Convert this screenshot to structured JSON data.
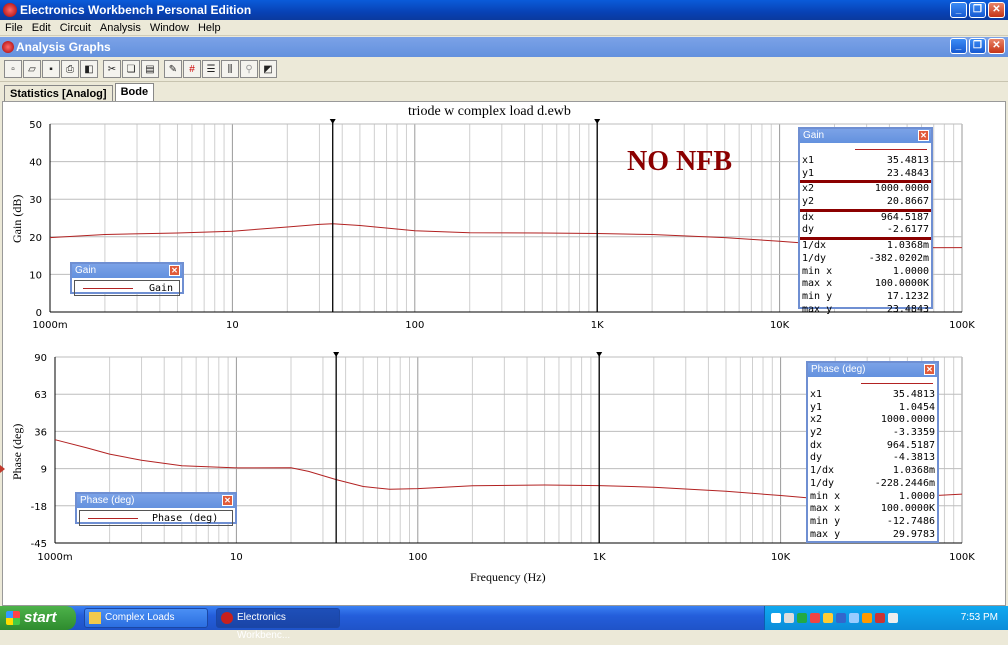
{
  "app": {
    "title": "Electronics Workbench Personal Edition"
  },
  "menu": [
    "File",
    "Edit",
    "Circuit",
    "Analysis",
    "Window",
    "Help"
  ],
  "subwindow": {
    "title": "Analysis Graphs"
  },
  "toolbar": [
    "new-icon",
    "open-icon",
    "save-icon",
    "print-icon",
    "print-preview-icon",
    "cut-icon",
    "copy-icon",
    "paste-icon",
    "properties-icon",
    "grid-icon",
    "legend-icon",
    "cursors-icon",
    "zoom-icon",
    "reverse-colors-icon"
  ],
  "tabs": [
    {
      "label": "Statistics [Analog]",
      "active": false
    },
    {
      "label": "Bode",
      "active": true
    }
  ],
  "graph": {
    "title": "triode w complex load d.ewb",
    "annotation": "NO NFB",
    "xlabel": "Frequency (Hz)"
  },
  "chart_data": [
    {
      "type": "line",
      "name": "Gain",
      "ylabel": "Gain (dB)",
      "xscale": "log",
      "xlim": [
        1,
        100000
      ],
      "ylim": [
        0,
        50
      ],
      "xticks": [
        "1000m",
        "10",
        "100",
        "1K",
        "10K",
        "100K"
      ],
      "yticks": [
        "0",
        "10",
        "20",
        "30",
        "40",
        "50"
      ],
      "grid": true,
      "series": [
        {
          "name": "Gain",
          "color": "#B22222",
          "x": [
            1,
            2,
            5,
            10,
            20,
            30,
            35.48,
            50,
            100,
            200,
            500,
            1000,
            2000,
            5000,
            10000,
            20000,
            50000,
            100000
          ],
          "y": [
            19.8,
            20.6,
            21.0,
            21.5,
            22.6,
            23.3,
            23.48,
            23.0,
            21.6,
            21.1,
            21.0,
            20.87,
            20.6,
            19.8,
            18.8,
            17.7,
            17.1,
            17.12
          ]
        }
      ],
      "cursors": {
        "x1": 35.4813,
        "x2": 1000
      }
    },
    {
      "type": "line",
      "name": "Phase (deg)",
      "ylabel": "Phase (deg)",
      "xscale": "log",
      "xlim": [
        1,
        100000
      ],
      "ylim": [
        -45,
        90
      ],
      "xticks": [
        "1000m",
        "10",
        "100",
        "1K",
        "10K",
        "100K"
      ],
      "yticks": [
        "-45",
        "-18",
        "9",
        "36",
        "63",
        "90"
      ],
      "grid": true,
      "series": [
        {
          "name": "Phase (deg)",
          "color": "#B22222",
          "x": [
            1,
            1.5,
            2,
            3,
            5,
            10,
            20,
            25,
            35.48,
            50,
            70,
            100,
            200,
            500,
            1000,
            2000,
            5000,
            10000,
            15000,
            30000,
            60000,
            100000
          ],
          "y": [
            29.97,
            24,
            19.5,
            15,
            11,
            9.5,
            9.6,
            7,
            1.05,
            -4,
            -6,
            -5.5,
            -3.5,
            -2.9,
            -3.34,
            -4.5,
            -7.5,
            -10.5,
            -12.5,
            -12.7,
            -11,
            -9.5
          ]
        }
      ],
      "cursors": {
        "x1": 35.4813,
        "x2": 1000
      }
    }
  ],
  "gain_cursor": {
    "title": "Gain",
    "rows": [
      {
        "k": "x1",
        "v": "35.4813"
      },
      {
        "k": "y1",
        "v": "23.4843"
      },
      {
        "k": "x2",
        "v": "1000.0000"
      },
      {
        "k": "y2",
        "v": "20.8667"
      },
      {
        "k": "dx",
        "v": "964.5187"
      },
      {
        "k": "dy",
        "v": "-2.6177"
      },
      {
        "k": "1/dx",
        "v": "1.0368m"
      },
      {
        "k": "1/dy",
        "v": "-382.0202m"
      },
      {
        "k": "min x",
        "v": "1.0000"
      },
      {
        "k": "max x",
        "v": "100.0000K"
      },
      {
        "k": "min y",
        "v": "17.1232"
      },
      {
        "k": "max y",
        "v": "23.4843"
      }
    ]
  },
  "phase_cursor": {
    "title": "Phase (deg)",
    "rows": [
      {
        "k": "x1",
        "v": "35.4813"
      },
      {
        "k": "y1",
        "v": "1.0454"
      },
      {
        "k": "x2",
        "v": "1000.0000"
      },
      {
        "k": "y2",
        "v": "-3.3359"
      },
      {
        "k": "dx",
        "v": "964.5187"
      },
      {
        "k": "dy",
        "v": "-4.3813"
      },
      {
        "k": "1/dx",
        "v": "1.0368m"
      },
      {
        "k": "1/dy",
        "v": "-228.2446m"
      },
      {
        "k": "min x",
        "v": "1.0000"
      },
      {
        "k": "max x",
        "v": "100.0000K"
      },
      {
        "k": "min y",
        "v": "-12.7486"
      },
      {
        "k": "max y",
        "v": "29.9783"
      }
    ]
  },
  "gain_legend": {
    "title": "Gain",
    "label": "Gain"
  },
  "phase_legend": {
    "title": "Phase (deg)",
    "label": "Phase (deg)"
  },
  "taskbar": {
    "start": "start",
    "tasks": [
      {
        "label": "Complex Loads",
        "active": false
      },
      {
        "label": "Electronics Workbenc...",
        "active": true
      }
    ],
    "clock": "7:53 PM"
  }
}
